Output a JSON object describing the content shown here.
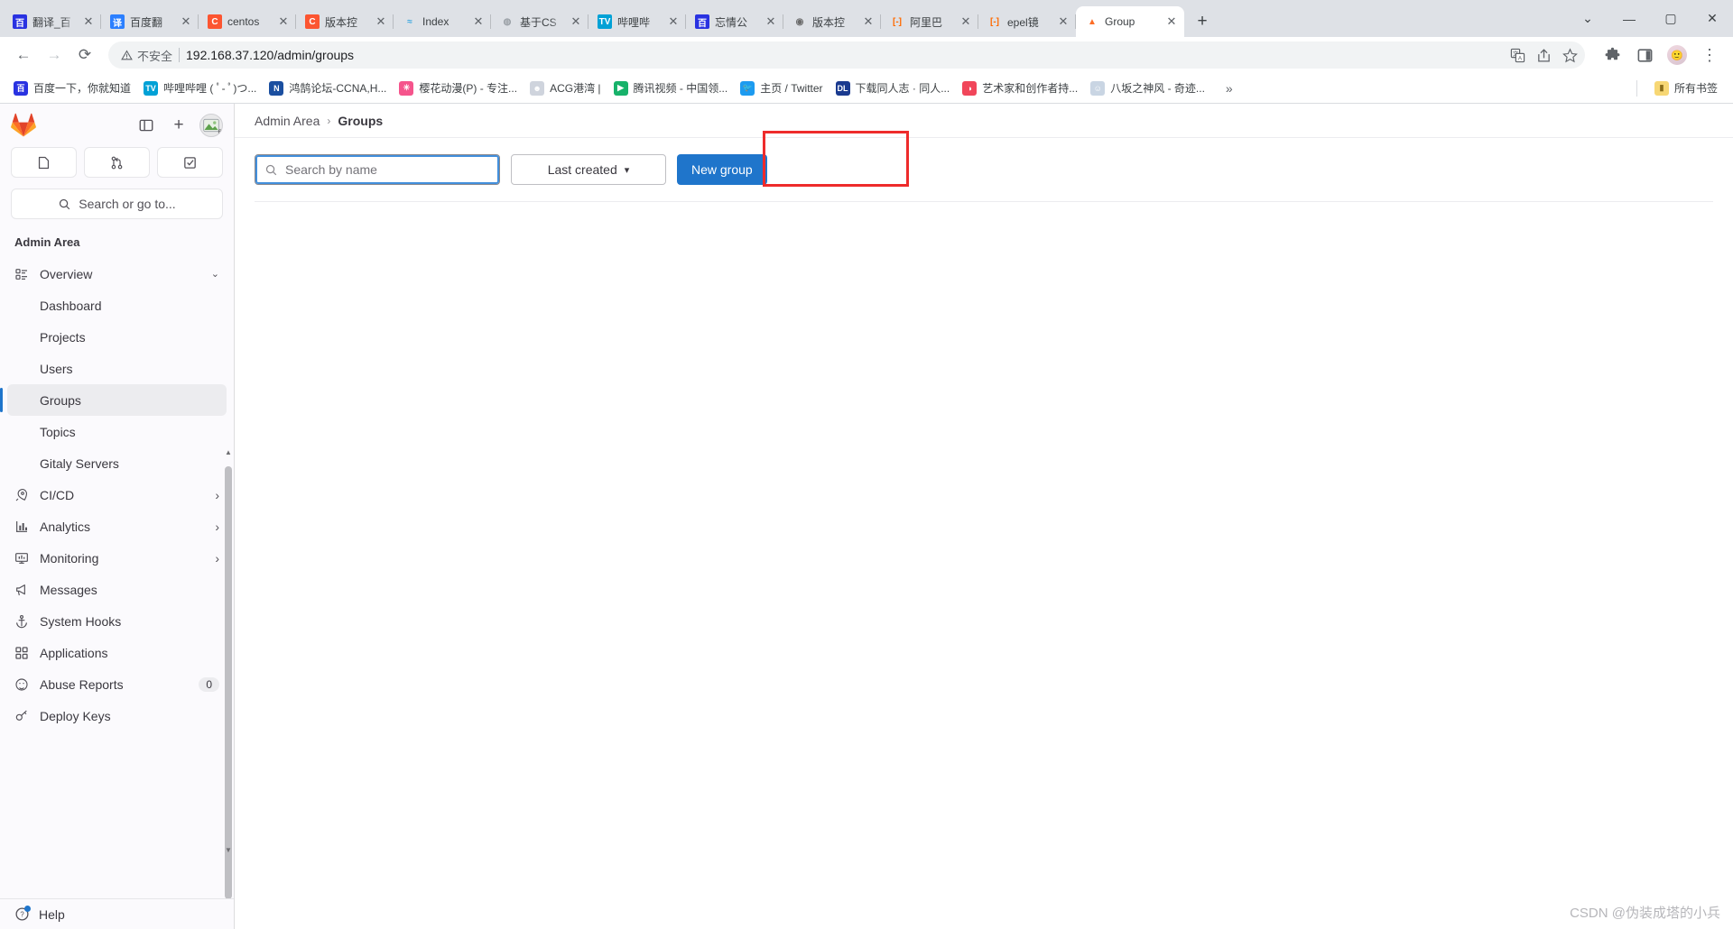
{
  "browser": {
    "tabs": [
      {
        "label": "翻译_百",
        "favicon": "baidu-icon",
        "color": "#2932e1",
        "glyph": "百"
      },
      {
        "label": "百度翻",
        "favicon": "baidu-fanyi-icon",
        "color": "#2b7fff",
        "glyph": "译"
      },
      {
        "label": "centos",
        "favicon": "csdn-icon",
        "color": "#fc5531",
        "glyph": "C"
      },
      {
        "label": "版本控",
        "favicon": "csdn-icon",
        "color": "#fc5531",
        "glyph": "C"
      },
      {
        "label": "Index  ",
        "favicon": "nginx-icon",
        "color": "#3aa7e0",
        "glyph": "≈"
      },
      {
        "label": "基于CS",
        "favicon": "generic-icon",
        "color": "#d9d9d9",
        "glyph": "◍"
      },
      {
        "label": "哔哩哔",
        "favicon": "bilibili-icon",
        "color": "#00a1d6",
        "glyph": "TV"
      },
      {
        "label": "忘情公",
        "favicon": "baidu-icon",
        "color": "#2932e1",
        "glyph": "百"
      },
      {
        "label": "版本控",
        "favicon": "globe-icon",
        "color": "#6b6b6b",
        "glyph": "◉"
      },
      {
        "label": "阿里巴",
        "favicon": "aliyun-icon",
        "color": "#ff6a00",
        "glyph": "[-]"
      },
      {
        "label": "epel镜",
        "favicon": "aliyun-icon",
        "color": "#ff6a00",
        "glyph": "[-]"
      },
      {
        "label": "Group ",
        "favicon": "gitlab-icon",
        "color": "#fc6d26",
        "glyph": "▲",
        "active": true
      }
    ],
    "close_label": "✕",
    "new_tab_label": "+",
    "window": {
      "minimize": "—",
      "maximize": "▢",
      "close": "✕",
      "tab_search": "⌄"
    },
    "nav": {
      "back": "←",
      "forward": "→",
      "reload": "⟳"
    },
    "omnibox": {
      "warning_icon": "not-secure-icon",
      "warning_text": "不安全",
      "url": "192.168.37.120/admin/groups",
      "translate_icon": "translate-icon",
      "share_icon": "share-icon",
      "star_icon": "bookmark-star-icon"
    },
    "toolbar_right": {
      "extensions_icon": "puzzle-icon",
      "sidepanel_icon": "side-panel-icon",
      "profile_icon": "profile-avatar",
      "menu_icon": "three-dot-menu-icon"
    },
    "bookmarks": [
      {
        "label": "百度一下，你就知道",
        "icon": "baidu-icon",
        "color": "#2932e1",
        "glyph": "百"
      },
      {
        "label": "哔哩哔哩 ( ﾟ- ﾟ)つ...",
        "icon": "bilibili-icon",
        "color": "#00a1d6",
        "glyph": "TV"
      },
      {
        "label": "鸿鹄论坛-CCNA,H...",
        "icon": "honghu-icon",
        "color": "#1b4fa0",
        "glyph": "N"
      },
      {
        "label": "樱花动漫(P) - 专注...",
        "icon": "sakura-icon",
        "color": "#f5548c",
        "glyph": "✳"
      },
      {
        "label": "ACG港湾 |",
        "icon": "acg-icon",
        "color": "#cfd4dd",
        "glyph": "☻"
      },
      {
        "label": "腾讯视频 - 中国领...",
        "icon": "tencent-video-icon",
        "color": "#17b26a",
        "glyph": "▶"
      },
      {
        "label": "主页 / Twitter",
        "icon": "twitter-icon",
        "color": "#1d9bf0",
        "glyph": "🐦"
      },
      {
        "label": "下载同人志 · 同人...",
        "icon": "dl-icon",
        "color": "#1a3a8f",
        "glyph": "DL"
      },
      {
        "label": "艺术家和创作者持...",
        "icon": "patreon-icon",
        "color": "#f1465a",
        "glyph": "◑"
      },
      {
        "label": "八坂之神风 - 奇迹...",
        "icon": "yasaka-icon",
        "color": "#c9d5e3",
        "glyph": "☺"
      }
    ],
    "bookmarks_overflow_label": "»",
    "all_bookmarks": {
      "label": "所有书签",
      "icon": "folder-icon"
    }
  },
  "gitlab": {
    "logo_name": "gitlab-logo",
    "top_actions": {
      "sidebar_toggle": "sidebar-toggle-icon",
      "create_new": "+",
      "avatar": "user-avatar"
    },
    "quick_buttons": [
      {
        "name": "issues-icon",
        "glyph": "issues"
      },
      {
        "name": "merge-requests-icon",
        "glyph": "merge"
      },
      {
        "name": "todos-icon",
        "glyph": "todo"
      }
    ],
    "search_placeholder": "Search or go to...",
    "nav_heading": "Admin Area",
    "nav_items": [
      {
        "label": "Overview",
        "icon": "overview-icon",
        "chevron": "down",
        "sub": false
      },
      {
        "label": "Dashboard",
        "icon": null,
        "sub": true
      },
      {
        "label": "Projects",
        "icon": null,
        "sub": true
      },
      {
        "label": "Users",
        "icon": null,
        "sub": true
      },
      {
        "label": "Groups",
        "icon": null,
        "sub": true,
        "active": true
      },
      {
        "label": "Topics",
        "icon": null,
        "sub": true
      },
      {
        "label": "Gitaly Servers",
        "icon": null,
        "sub": true
      },
      {
        "label": "CI/CD",
        "icon": "rocket-icon",
        "chevron": "right",
        "sub": false
      },
      {
        "label": "Analytics",
        "icon": "analytics-icon",
        "chevron": "right",
        "sub": false
      },
      {
        "label": "Monitoring",
        "icon": "monitor-icon",
        "chevron": "right",
        "sub": false
      },
      {
        "label": "Messages",
        "icon": "megaphone-icon",
        "sub": false
      },
      {
        "label": "System Hooks",
        "icon": "anchor-icon",
        "sub": false
      },
      {
        "label": "Applications",
        "icon": "applications-icon",
        "sub": false
      },
      {
        "label": "Abuse Reports",
        "icon": "abuse-icon",
        "sub": false,
        "badge": "0"
      },
      {
        "label": "Deploy Keys",
        "icon": "key-icon",
        "sub": false
      }
    ],
    "help": {
      "label": "Help",
      "icon": "help-icon"
    },
    "breadcrumb": {
      "root": "Admin Area",
      "separator": "›",
      "current": "Groups"
    },
    "filters": {
      "search_placeholder": "Search by name",
      "search_value": "",
      "search_icon": "search-icon",
      "sort_label": "Last created",
      "sort_chevron": "⌄",
      "new_group_label": "New group"
    },
    "accent_colors": {
      "primary_button": "#1f75cb",
      "focus_outline": "#428fdc",
      "highlight_box": "#ee2b2b",
      "active_nav_bar": "#1f75cb"
    }
  },
  "watermark": "CSDN @伪装成塔的小兵"
}
